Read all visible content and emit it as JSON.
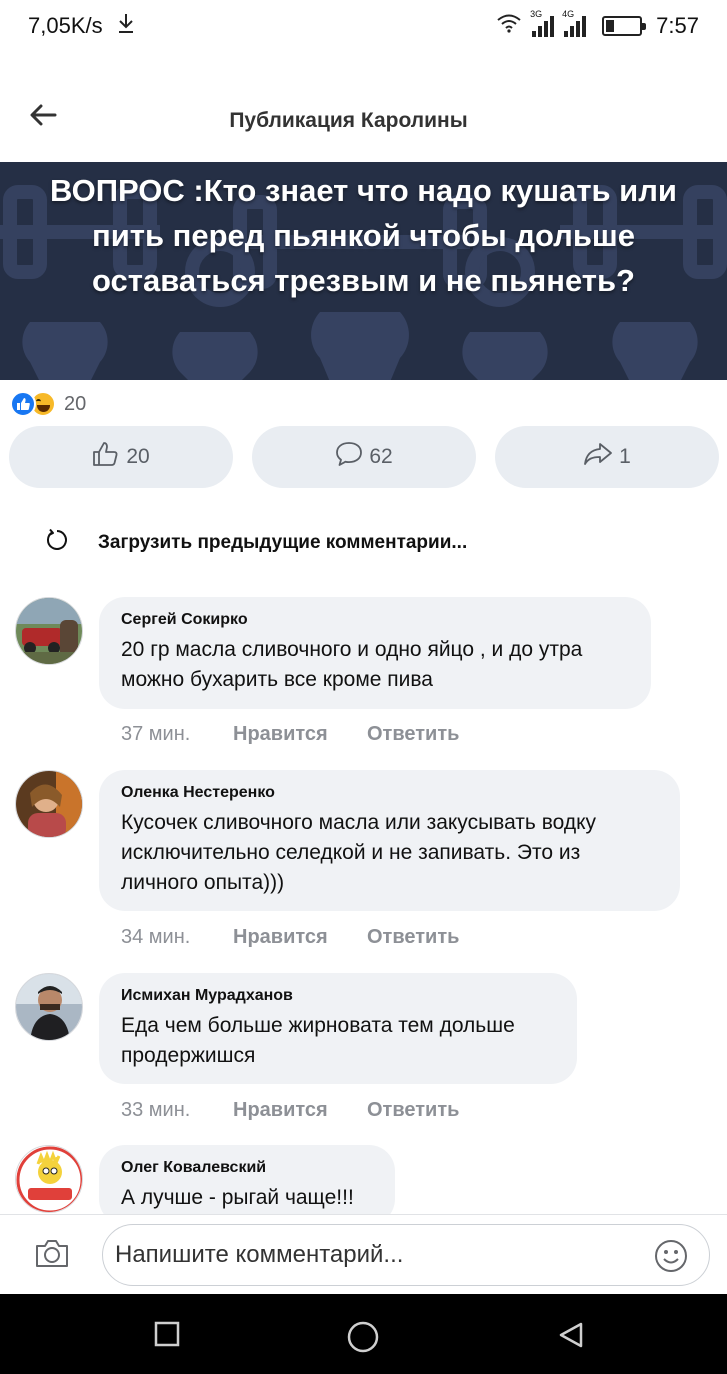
{
  "status_bar": {
    "speed": "7,05K/s",
    "net1": "3G",
    "net2": "4G",
    "time": "7:57",
    "battery_level": 0.25,
    "icons": [
      "download-icon",
      "wifi-icon",
      "signal-icon",
      "battery-icon"
    ]
  },
  "header": {
    "title": "Публикация Каролины",
    "back_icon": "arrow-left-icon"
  },
  "post": {
    "text": "ВОПРОС :Кто знает что надо кушать или пить перед пьянкой чтобы дольше оставаться трезвым и не пьянеть?",
    "background_color": "#252f45",
    "reaction_icons": [
      "like-reaction-icon",
      "haha-reaction-icon"
    ],
    "reaction_count": "20"
  },
  "actions": {
    "like_count": "20",
    "comment_count": "62",
    "share_count": "1",
    "button_color": "#e9edf2"
  },
  "load_previous": {
    "label": "Загрузить предыдущие комментарии..."
  },
  "comments": [
    {
      "author": "Сергей Сокирко",
      "text": "20 гр масла сливочного и одно яйцо , и до утра можно бухарить все кроме пива",
      "time": "37 мин.",
      "like_label": "Нравится",
      "reply_label": "Ответить"
    },
    {
      "author": "Оленка Нестеренко",
      "text": "Кусочек сливочного масла или закусывать водку исключительно селедкой и не запивать. Это из личного опыта)))",
      "time": "34 мин.",
      "like_label": "Нравится",
      "reply_label": "Ответить"
    },
    {
      "author": "Исмихан Мурадханов",
      "text": "Еда чем больше жирновата тем дольше продержишся",
      "time": "33 мин.",
      "like_label": "Нравится",
      "reply_label": "Ответить"
    },
    {
      "author": "Олег Ковалевский",
      "text": "А лучше - рыгай чаще!!!"
    }
  ],
  "comment_input": {
    "placeholder": "Напишите комментарий..."
  },
  "nav_bar": {
    "icons": [
      "recents-square-icon",
      "home-circle-icon",
      "back-triangle-icon"
    ]
  }
}
